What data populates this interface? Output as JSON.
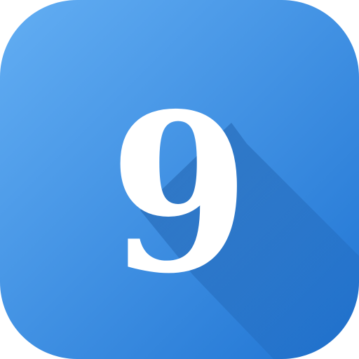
{
  "icon": {
    "digit": "9",
    "icon_name": "number-nine-icon",
    "colors": {
      "tile_top_left": "#63aef3",
      "tile_bottom_right": "#1f74d3",
      "shadow": "#1b5aa6",
      "digit": "#ffffff"
    }
  }
}
